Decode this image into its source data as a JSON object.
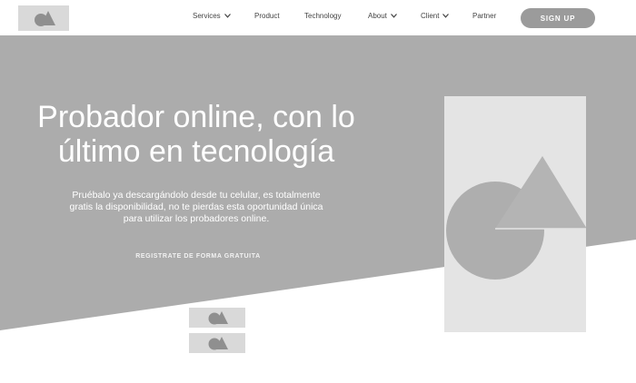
{
  "header": {
    "logo_icon": "logo-shapes-icon",
    "nav": [
      {
        "label": "Services",
        "has_dropdown": true
      },
      {
        "label": "Product",
        "has_dropdown": false
      },
      {
        "label": "Technology",
        "has_dropdown": false
      },
      {
        "label": "About",
        "has_dropdown": true
      },
      {
        "label": "Client",
        "has_dropdown": true
      },
      {
        "label": "Partner",
        "has_dropdown": false
      }
    ],
    "signup_label": "SIGN UP"
  },
  "hero": {
    "title_line1": "Probador online, con lo",
    "title_line2": "último en tecnología",
    "desc_line1": "Pruébalo ya descargándolo desde tu celular, es totalmente",
    "desc_line2": "gratis la disponibilidad, no te pierdas esta oportunidad única",
    "desc_line3": "para utilizar los probadores online.",
    "cta_label": "REGISTRATE DE FORMA GRATUITA",
    "image_icon": "circle-triangle-illustration"
  },
  "badges": {
    "icon": "logo-shapes-icon",
    "count": 2
  },
  "colors": {
    "hero_bg": "#acacac",
    "header_bg": "#ffffff",
    "placeholder": "#d9d9d9",
    "image_panel": "#e4e4e4",
    "shape": "#aeaeae",
    "signup_bg": "#9b9b9b",
    "text_light": "#ffffff",
    "nav_text": "#444444"
  }
}
